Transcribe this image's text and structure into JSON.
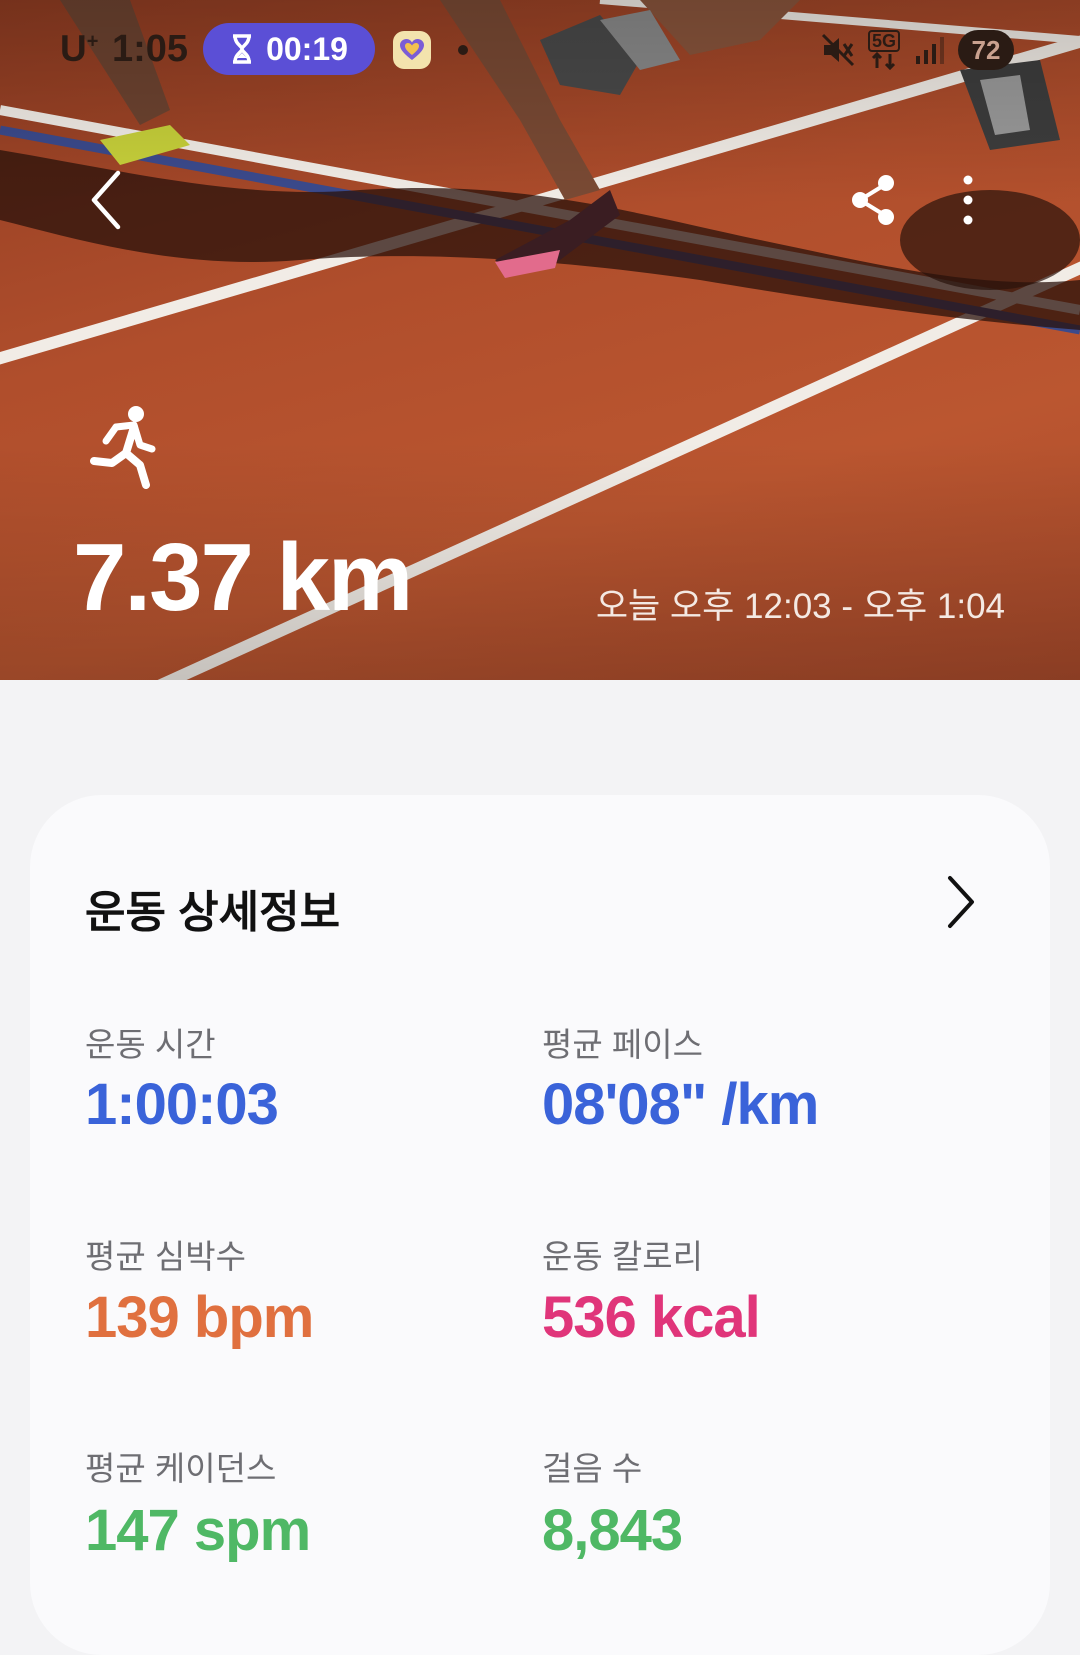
{
  "status_bar": {
    "carrier": "U",
    "carrier_plus": "+",
    "time": "1:05",
    "timer": "00:19",
    "network": "5G",
    "battery": "72"
  },
  "hero": {
    "distance": "7.37 km",
    "time_range": "오늘 오후 12:03 - 오후 1:04"
  },
  "details": {
    "title": "운동 상세정보",
    "stats": [
      {
        "label": "운동 시간",
        "value": "1:00:03",
        "color": "#3a63d9"
      },
      {
        "label": "평균 페이스",
        "value": "08'08\" /km",
        "color": "#3a63d9"
      },
      {
        "label": "평균 심박수",
        "value": "139 bpm",
        "color": "#e0703f"
      },
      {
        "label": "운동 칼로리",
        "value": "536 kcal",
        "color": "#e0357a"
      },
      {
        "label": "평균 케이던스",
        "value": "147 spm",
        "color": "#4fb865"
      },
      {
        "label": "걸음 수",
        "value": "8,843",
        "color": "#4fb865"
      }
    ]
  },
  "icons": {
    "back": "chevron-left-icon",
    "share": "share-icon",
    "more": "more-vertical-icon",
    "run": "running-icon",
    "detail_arrow": "chevron-right-icon"
  }
}
